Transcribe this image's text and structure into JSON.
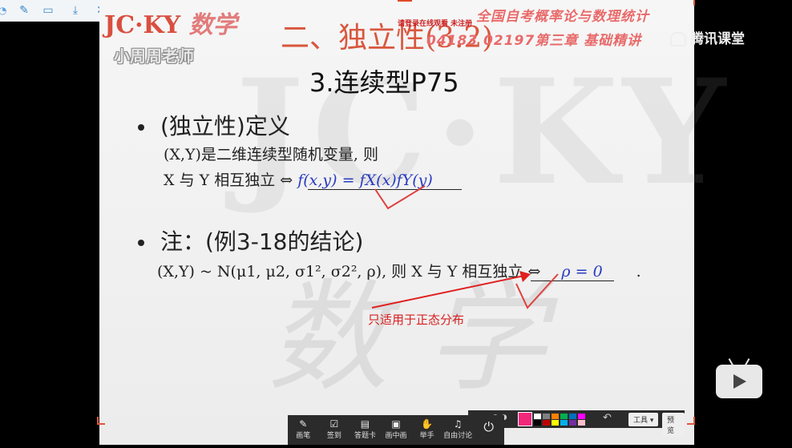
{
  "slide": {
    "logo_jcky": "JC·KY",
    "logo_shuxue": "数学",
    "teacher": "小周周老师",
    "chapter_title": "二、独立性(3.2)",
    "banner_line1": "全国自考概率论与数理统计",
    "banner_line2": "04183  02197第三章 基础精讲",
    "notice": "请登录在线观看  未注册",
    "section_title": "3.连续型P75",
    "bullet1": "(独立性)定义",
    "line1": "(X,Y)是二维连续型随机变量, 则",
    "line2_text": "X 与 Y 相互独立 ⇔ ",
    "line2_formula": "f(x,y) = fX(x)fY(y)",
    "bullet2": "注：(例3-18的结论)",
    "line3_text": "(X,Y) ~ N(μ1, μ2, σ1², σ2², ρ), 则 X 与 Y 相互独立 ⇔ ",
    "line3_formula": "ρ = 0",
    "line3_period": ".",
    "annotation": "只适用于正态分布",
    "watermark": "JC·KY",
    "watermark_shu": "数 学"
  },
  "right_panel": {
    "tencent_label": "腾讯课堂"
  },
  "toolbar": {
    "items": [
      {
        "label": "画笔",
        "icon": "pen-icon"
      },
      {
        "label": "签到",
        "icon": "checkin-icon"
      },
      {
        "label": "答题卡",
        "icon": "answer-card-icon"
      },
      {
        "label": "画中画",
        "icon": "pip-icon"
      },
      {
        "label": "举手",
        "icon": "raise-hand-icon"
      },
      {
        "label": "自由讨论",
        "icon": "discussion-icon"
      },
      {
        "label": "",
        "icon": "power-icon"
      }
    ]
  },
  "palette": {
    "tool_label": "工具",
    "preview_label": "预览",
    "selected_color": "#f2287a",
    "colors": [
      "#ffffff",
      "#000000",
      "#808080",
      "#c00000",
      "#ff8000",
      "#ffff00",
      "#00b050",
      "#00b0f0",
      "#0070c0",
      "#7030a0",
      "#ff00ff",
      "#ffc0cb"
    ]
  },
  "colors": {
    "accent_red": "#d9573e",
    "formula_blue": "#2a3cc0",
    "background": "#000000"
  }
}
